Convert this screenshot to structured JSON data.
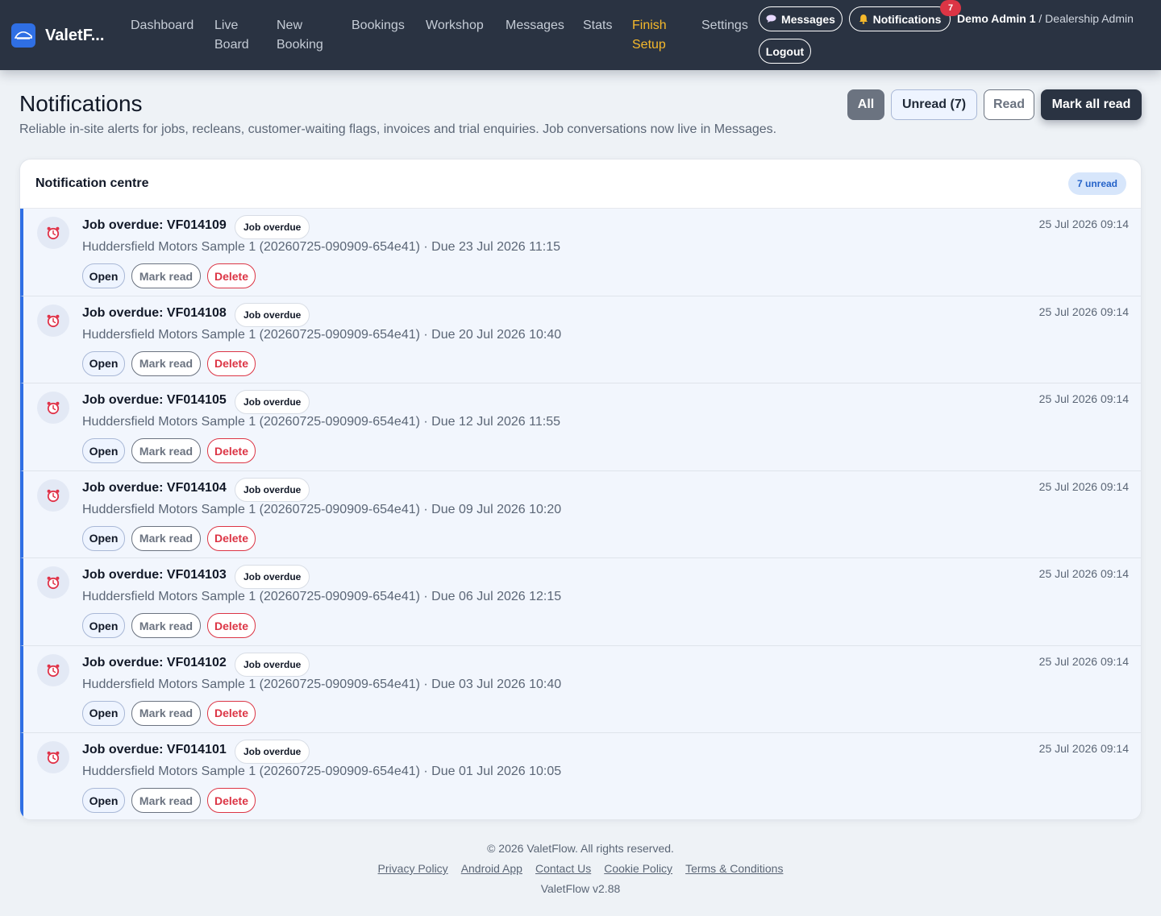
{
  "app": {
    "name": "ValetF...",
    "brand_color": "#2f6fe4",
    "logo_icon": "car-icon"
  },
  "nav": {
    "items": [
      {
        "id": "dashboard",
        "label": "Dashboard"
      },
      {
        "id": "live-board",
        "label": "Live Board"
      },
      {
        "id": "new-booking",
        "label": "New Booking"
      },
      {
        "id": "bookings",
        "label": "Bookings"
      },
      {
        "id": "workshop",
        "label": "Workshop"
      },
      {
        "id": "messages",
        "label": "Messages"
      },
      {
        "id": "stats",
        "label": "Stats"
      },
      {
        "id": "finish-setup",
        "label": "Finish Setup",
        "accent": "#f6b92b"
      },
      {
        "id": "settings",
        "label": "Settings"
      }
    ],
    "messages_button": {
      "label": "Messages",
      "icon": "speech-bubble-icon"
    },
    "notifications_button": {
      "label": "Notifications",
      "icon": "bell-icon",
      "badge": "7"
    },
    "user": {
      "name": "Demo Admin 1",
      "role": "Dealership Admin"
    },
    "logout_label": "Logout"
  },
  "header": {
    "title": "Notifications",
    "subtitle": "Reliable in-site alerts for jobs, recleans, customer-waiting flags, invoices and trial enquiries. Job conversations now live in Messages.",
    "filters": {
      "all": "All",
      "unread": "Unread (7)",
      "read": "Read",
      "active": "All"
    },
    "mark_all_label": "Mark all read"
  },
  "card": {
    "title": "Notification centre",
    "unread_badge": "7 unread"
  },
  "notification_actions": {
    "open": "Open",
    "mark_read": "Mark read",
    "delete": "Delete"
  },
  "notifications": [
    {
      "title": "Job overdue: VF014109",
      "type": "Job overdue",
      "icon": "alarm-clock-icon",
      "desc": "Huddersfield Motors Sample 1 (20260725-090909-654e41) · Due 23 Jul 2026 11:15",
      "time": "25 Jul 2026 09:14",
      "unread": true
    },
    {
      "title": "Job overdue: VF014108",
      "type": "Job overdue",
      "icon": "alarm-clock-icon",
      "desc": "Huddersfield Motors Sample 1 (20260725-090909-654e41) · Due 20 Jul 2026 10:40",
      "time": "25 Jul 2026 09:14",
      "unread": true
    },
    {
      "title": "Job overdue: VF014105",
      "type": "Job overdue",
      "icon": "alarm-clock-icon",
      "desc": "Huddersfield Motors Sample 1 (20260725-090909-654e41) · Due 12 Jul 2026 11:55",
      "time": "25 Jul 2026 09:14",
      "unread": true
    },
    {
      "title": "Job overdue: VF014104",
      "type": "Job overdue",
      "icon": "alarm-clock-icon",
      "desc": "Huddersfield Motors Sample 1 (20260725-090909-654e41) · Due 09 Jul 2026 10:20",
      "time": "25 Jul 2026 09:14",
      "unread": true
    },
    {
      "title": "Job overdue: VF014103",
      "type": "Job overdue",
      "icon": "alarm-clock-icon",
      "desc": "Huddersfield Motors Sample 1 (20260725-090909-654e41) · Due 06 Jul 2026 12:15",
      "time": "25 Jul 2026 09:14",
      "unread": true
    },
    {
      "title": "Job overdue: VF014102",
      "type": "Job overdue",
      "icon": "alarm-clock-icon",
      "desc": "Huddersfield Motors Sample 1 (20260725-090909-654e41) · Due 03 Jul 2026 10:40",
      "time": "25 Jul 2026 09:14",
      "unread": true
    },
    {
      "title": "Job overdue: VF014101",
      "type": "Job overdue",
      "icon": "alarm-clock-icon",
      "desc": "Huddersfield Motors Sample 1 (20260725-090909-654e41) · Due 01 Jul 2026 10:05",
      "time": "25 Jul 2026 09:14",
      "unread": true
    }
  ],
  "footer": {
    "copyright": "© 2026 ValetFlow. All rights reserved.",
    "links": [
      "Privacy Policy",
      "Android App",
      "Contact Us",
      "Cookie Policy",
      "Terms & Conditions"
    ],
    "version": "ValetFlow v2.88"
  },
  "colors": {
    "topbar": "#2a3342",
    "accent_blue": "#2f6fe4",
    "danger": "#dc3545",
    "unread_row_bg": "#f2f6fd"
  }
}
